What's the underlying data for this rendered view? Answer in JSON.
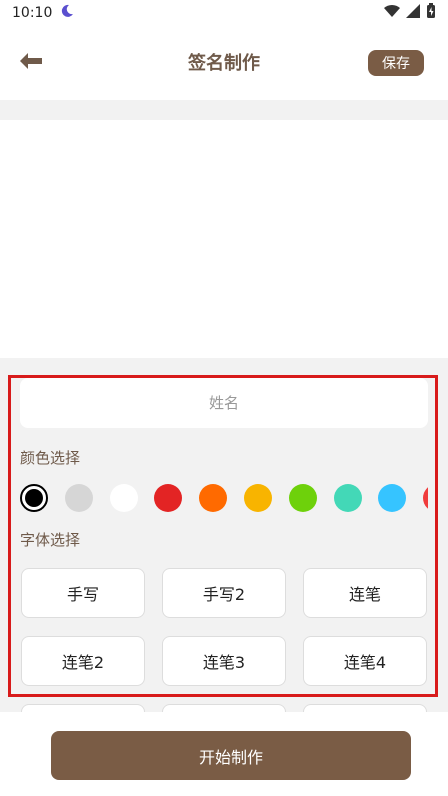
{
  "status_bar": {
    "time": "10:10"
  },
  "header": {
    "title": "签名制作",
    "save_label": "保存"
  },
  "name_input": {
    "value": "",
    "placeholder": "姓名"
  },
  "color_section": {
    "label": "颜色选择"
  },
  "colors": [
    "#000000",
    "#d6d6d6",
    "#ffffff",
    "#e32424",
    "#ff6a00",
    "#f8b400",
    "#6ed10b",
    "#43d8b7",
    "#36c4ff",
    "#f03c3c"
  ],
  "selected_color": "#000000",
  "font_section": {
    "label": "字体选择"
  },
  "fonts": [
    "手写",
    "手写2",
    "连笔",
    "连笔2",
    "连笔3",
    "连笔4"
  ],
  "footer": {
    "start_label": "开始制作"
  }
}
